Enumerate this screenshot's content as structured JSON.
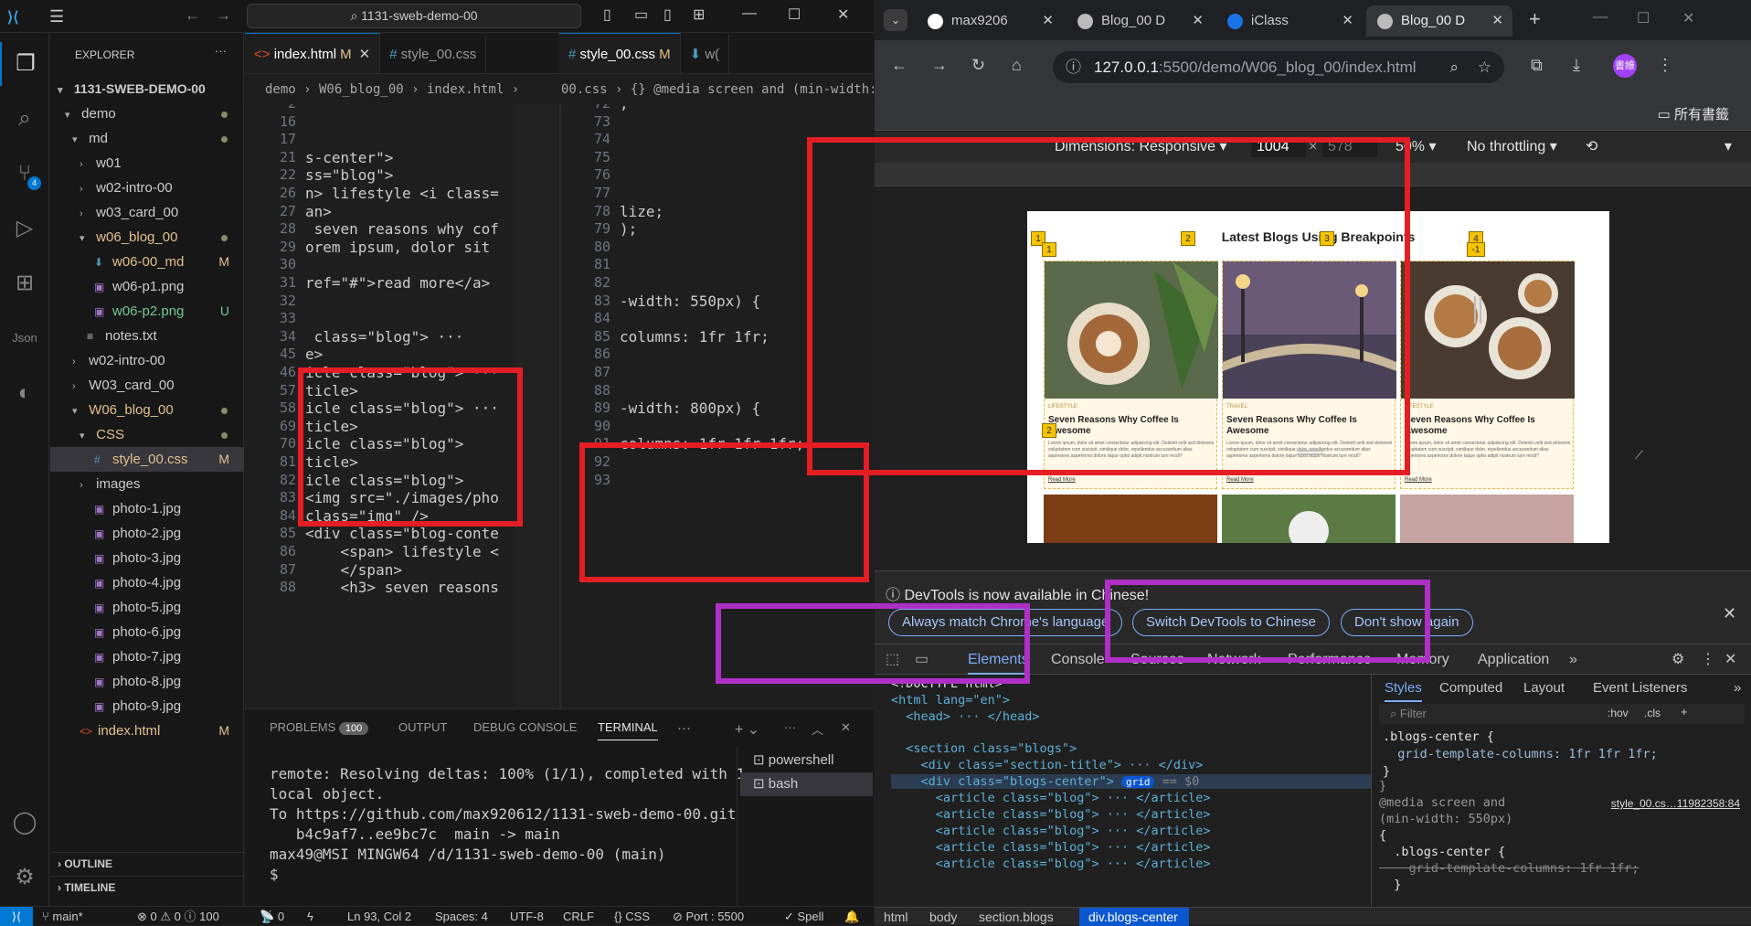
{
  "vscode": {
    "title_bar": {
      "search": "1131-sweb-demo-00"
    },
    "explorer": {
      "header": "EXPLORER",
      "root": "1131-SWEB-DEMO-00",
      "items": [
        {
          "label": "demo"
        },
        {
          "label": "md"
        },
        {
          "label": "w01"
        },
        {
          "label": "w02-intro-00"
        },
        {
          "label": "w03_card_00"
        },
        {
          "label": "w06_blog_00"
        },
        {
          "label": "w06-00_md",
          "status": "M"
        },
        {
          "label": "w06-p1.png"
        },
        {
          "label": "w06-p2.png",
          "status": "U"
        },
        {
          "label": "notes.txt"
        },
        {
          "label": "w02-intro-00"
        },
        {
          "label": "W03_card_00"
        },
        {
          "label": "W06_blog_00"
        },
        {
          "label": "CSS"
        },
        {
          "label": "style_00.css",
          "status": "M"
        },
        {
          "label": "images"
        },
        {
          "label": "photo-1.jpg"
        },
        {
          "label": "photo-2.jpg"
        },
        {
          "label": "photo-3.jpg"
        },
        {
          "label": "photo-4.jpg"
        },
        {
          "label": "photo-5.jpg"
        },
        {
          "label": "photo-6.jpg"
        },
        {
          "label": "photo-7.jpg"
        },
        {
          "label": "photo-8.jpg"
        },
        {
          "label": "photo-9.jpg"
        },
        {
          "label": "index.html",
          "status": "M"
        }
      ],
      "outline": "OUTLINE",
      "timeline": "TIMELINE"
    },
    "badge_scm": "4",
    "left_tabs": [
      {
        "label": "index.html",
        "status": "M"
      },
      {
        "label": "style_00.css"
      }
    ],
    "right_tabs": [
      {
        "label": "style_00.css",
        "status": "M"
      },
      {
        "label": "w("
      }
    ],
    "left_breadcrumb": "demo  ›  W06_blog_00  ›  index.html  ›",
    "right_breadcrumb": "00.css  ›  {} @media screen and (min-width: ...",
    "left_lines": [
      {
        "n": "2",
        "t": ""
      },
      {
        "n": "16",
        "t": ""
      },
      {
        "n": "17",
        "t": ""
      },
      {
        "n": "21",
        "t": "s-center\">"
      },
      {
        "n": "22",
        "t": "ss=\"blog\">"
      },
      {
        "n": "26",
        "t": "n> lifestyle <i class="
      },
      {
        "n": "27",
        "t": "an>"
      },
      {
        "n": "28",
        "t": " seven reasons why cof"
      },
      {
        "n": "29",
        "t": "orem ipsum, dolor sit"
      },
      {
        "n": "30",
        "t": ""
      },
      {
        "n": "31",
        "t": "ref=\"#\">read more</a>"
      },
      {
        "n": "32",
        "t": ""
      },
      {
        "n": "33",
        "t": ""
      },
      {
        "n": "34",
        "t": " class=\"blog\"> ···"
      },
      {
        "n": "45",
        "t": "e>"
      },
      {
        "n": "46",
        "t": "icle class=\"blog\"> ···"
      },
      {
        "n": "57",
        "t": "ticle>"
      },
      {
        "n": "58",
        "t": "icle class=\"blog\"> ···"
      },
      {
        "n": "69",
        "t": "ticle>"
      },
      {
        "n": "70",
        "t": "icle class=\"blog\">"
      },
      {
        "n": "81",
        "t": "ticle>"
      },
      {
        "n": "82",
        "t": "icle class=\"blog\">"
      },
      {
        "n": "83",
        "t": "<img src=\"./images/pho"
      },
      {
        "n": "84",
        "t": "class=\"img\" />"
      },
      {
        "n": "85",
        "t": "<div class=\"blog-conte"
      },
      {
        "n": "86",
        "t": "    <span> lifestyle <"
      },
      {
        "n": "87",
        "t": "    </span>"
      },
      {
        "n": "88",
        "t": "    <h3> seven reasons"
      }
    ],
    "right_lines": [
      {
        "n": "72",
        "t": ";"
      },
      {
        "n": "73",
        "t": ""
      },
      {
        "n": "74",
        "t": ""
      },
      {
        "n": "75",
        "t": ""
      },
      {
        "n": "76",
        "t": ""
      },
      {
        "n": "77",
        "t": ""
      },
      {
        "n": "78",
        "t": "lize;"
      },
      {
        "n": "79",
        "t": ");"
      },
      {
        "n": "80",
        "t": ""
      },
      {
        "n": "81",
        "t": ""
      },
      {
        "n": "82",
        "t": ""
      },
      {
        "n": "83",
        "t": "-width: 550px) {"
      },
      {
        "n": "84",
        "t": ""
      },
      {
        "n": "85",
        "t": "columns: 1fr 1fr;"
      },
      {
        "n": "86",
        "t": ""
      },
      {
        "n": "87",
        "t": ""
      },
      {
        "n": "88",
        "t": ""
      },
      {
        "n": "89",
        "t": "-width: 800px) {"
      },
      {
        "n": "90",
        "t": ""
      },
      {
        "n": "91",
        "t": "columns: 1fr 1fr 1fr;"
      },
      {
        "n": "92",
        "t": ""
      },
      {
        "n": "93",
        "t": ""
      }
    ],
    "panel": {
      "tabs": [
        "PROBLEMS",
        "OUTPUT",
        "DEBUG CONSOLE",
        "TERMINAL"
      ],
      "problems_count": "100",
      "terminal_lines": [
        "remote: Resolving deltas: 100% (1/1), completed with 1",
        "local object.",
        "To https://github.com/max920612/1131-sweb-demo-00.git",
        "   b4c9af7..ee9bc7c  main -> main",
        "",
        "max49@MSI MINGW64 /d/1131-sweb-demo-00 (main)",
        "$ "
      ],
      "shells": [
        "powershell",
        "bash"
      ]
    },
    "status_bar": {
      "branch": "main*",
      "errors": "0",
      "warnings": "0",
      "info": "100",
      "ports": "0",
      "position": "Ln 93, Col 2",
      "spaces": "Spaces: 4",
      "encoding": "UTF-8",
      "eol": "CRLF",
      "lang": "CSS",
      "port": "Port : 5500",
      "spell": "Spell"
    }
  },
  "chrome": {
    "tabs": [
      {
        "label": "max9206"
      },
      {
        "label": "Blog_00 D"
      },
      {
        "label": "iClass"
      },
      {
        "label": "Blog_00 D"
      }
    ],
    "url_host": "127.0.0.1",
    "url_path": ":5500/demo/W06_blog_00/index.html",
    "profile": "書維",
    "bookmarks": "所有書籤",
    "device": {
      "dimensions_label": "Dimensions: Responsive",
      "width": "1004",
      "height": "578",
      "zoom": "50%",
      "throttle": "No throttling"
    },
    "site": {
      "title": "Latest Blogs Using Breakpoints",
      "cards": [
        {
          "tag": "LIFESTYLE",
          "title": "Seven Reasons Why Coffee Is Awesome",
          "text": "Lorem ipsum, dolor sit amet consectetur adipisicing elit. Deleniti velit sed doloremi voluptatem cum suscipit, similique dolor, repellendus accusantium alias asperiores asperiores dolore laque optio adipit nostrum iure modi?",
          "more": "Read More"
        },
        {
          "tag": "TRAVEL",
          "title": "Seven Reasons Why Coffee Is Awesome",
          "text": "Lorem ipsum, dolor sit amet consectetur adipisicing elit. Deleniti velit sed doloremi voluptatem cum suscipit, similique dolor, repellendus accusantium alias asperiores asperiores dolore laque optio adipit nostrum iure modi?",
          "more": "Read More"
        },
        {
          "tag": "LIFESTYLE",
          "title": "Seven Reasons Why Coffee Is Awesome",
          "text": "Lorem ipsum, dolor sit amet consectetur adipisicing elit. Deleniti velit sed doloremi voluptatem cum suscipit, similique dolor, repellendus accusantium alias asperiores asperiores dolore laque optio adipit nostrum iure modi?",
          "more": "Read More"
        }
      ],
      "grid_labels": [
        "1",
        "1",
        "2",
        "3",
        "4",
        "-1",
        "2"
      ]
    },
    "notice": {
      "text": "DevTools is now available in Chinese!",
      "buttons": [
        "Always match Chrome's language",
        "Switch DevTools to Chinese",
        "Don't show again"
      ]
    },
    "devtools_tabs": [
      "Elements",
      "Console",
      "Sources",
      "Network",
      "Performance",
      "Memory",
      "Application"
    ],
    "dom_lines": [
      "<!DOCTYPE html>",
      "<html lang=\"en\">",
      "  <head> ··· </head>",
      "",
      "  <section class=\"blogs\">",
      "    <div class=\"section-title\"> ··· </div>",
      "    <div class=\"blogs-center\">",
      "      <article class=\"blog\"> ··· </article>",
      "      <article class=\"blog\"> ··· </article>",
      "      <article class=\"blog\"> ··· </article>",
      "      <article class=\"blog\"> ··· </article>",
      "      <article class=\"blog\"> ··· </article>"
    ],
    "grid_pill": "grid",
    "dollar0": "== $0",
    "styles_tabs": [
      "Styles",
      "Computed",
      "Layout",
      "Event Listeners"
    ],
    "filter_placeholder": "Filter",
    "hov": ":hov",
    "cls": ".cls",
    "style_rules": [
      ".blogs-center {",
      "  grid-template-columns: 1fr 1fr 1fr;",
      "}",
      "}",
      "@media screen and",
      "(min-width: 550px)",
      "{",
      "  .blogs-center {",
      "    grid-template-columns: 1fr 1fr;",
      "  }"
    ],
    "style_source": "style_00.cs…11982358:84",
    "breadcrumb": [
      "html",
      "body",
      "section.blogs",
      "div.blogs-center"
    ]
  }
}
